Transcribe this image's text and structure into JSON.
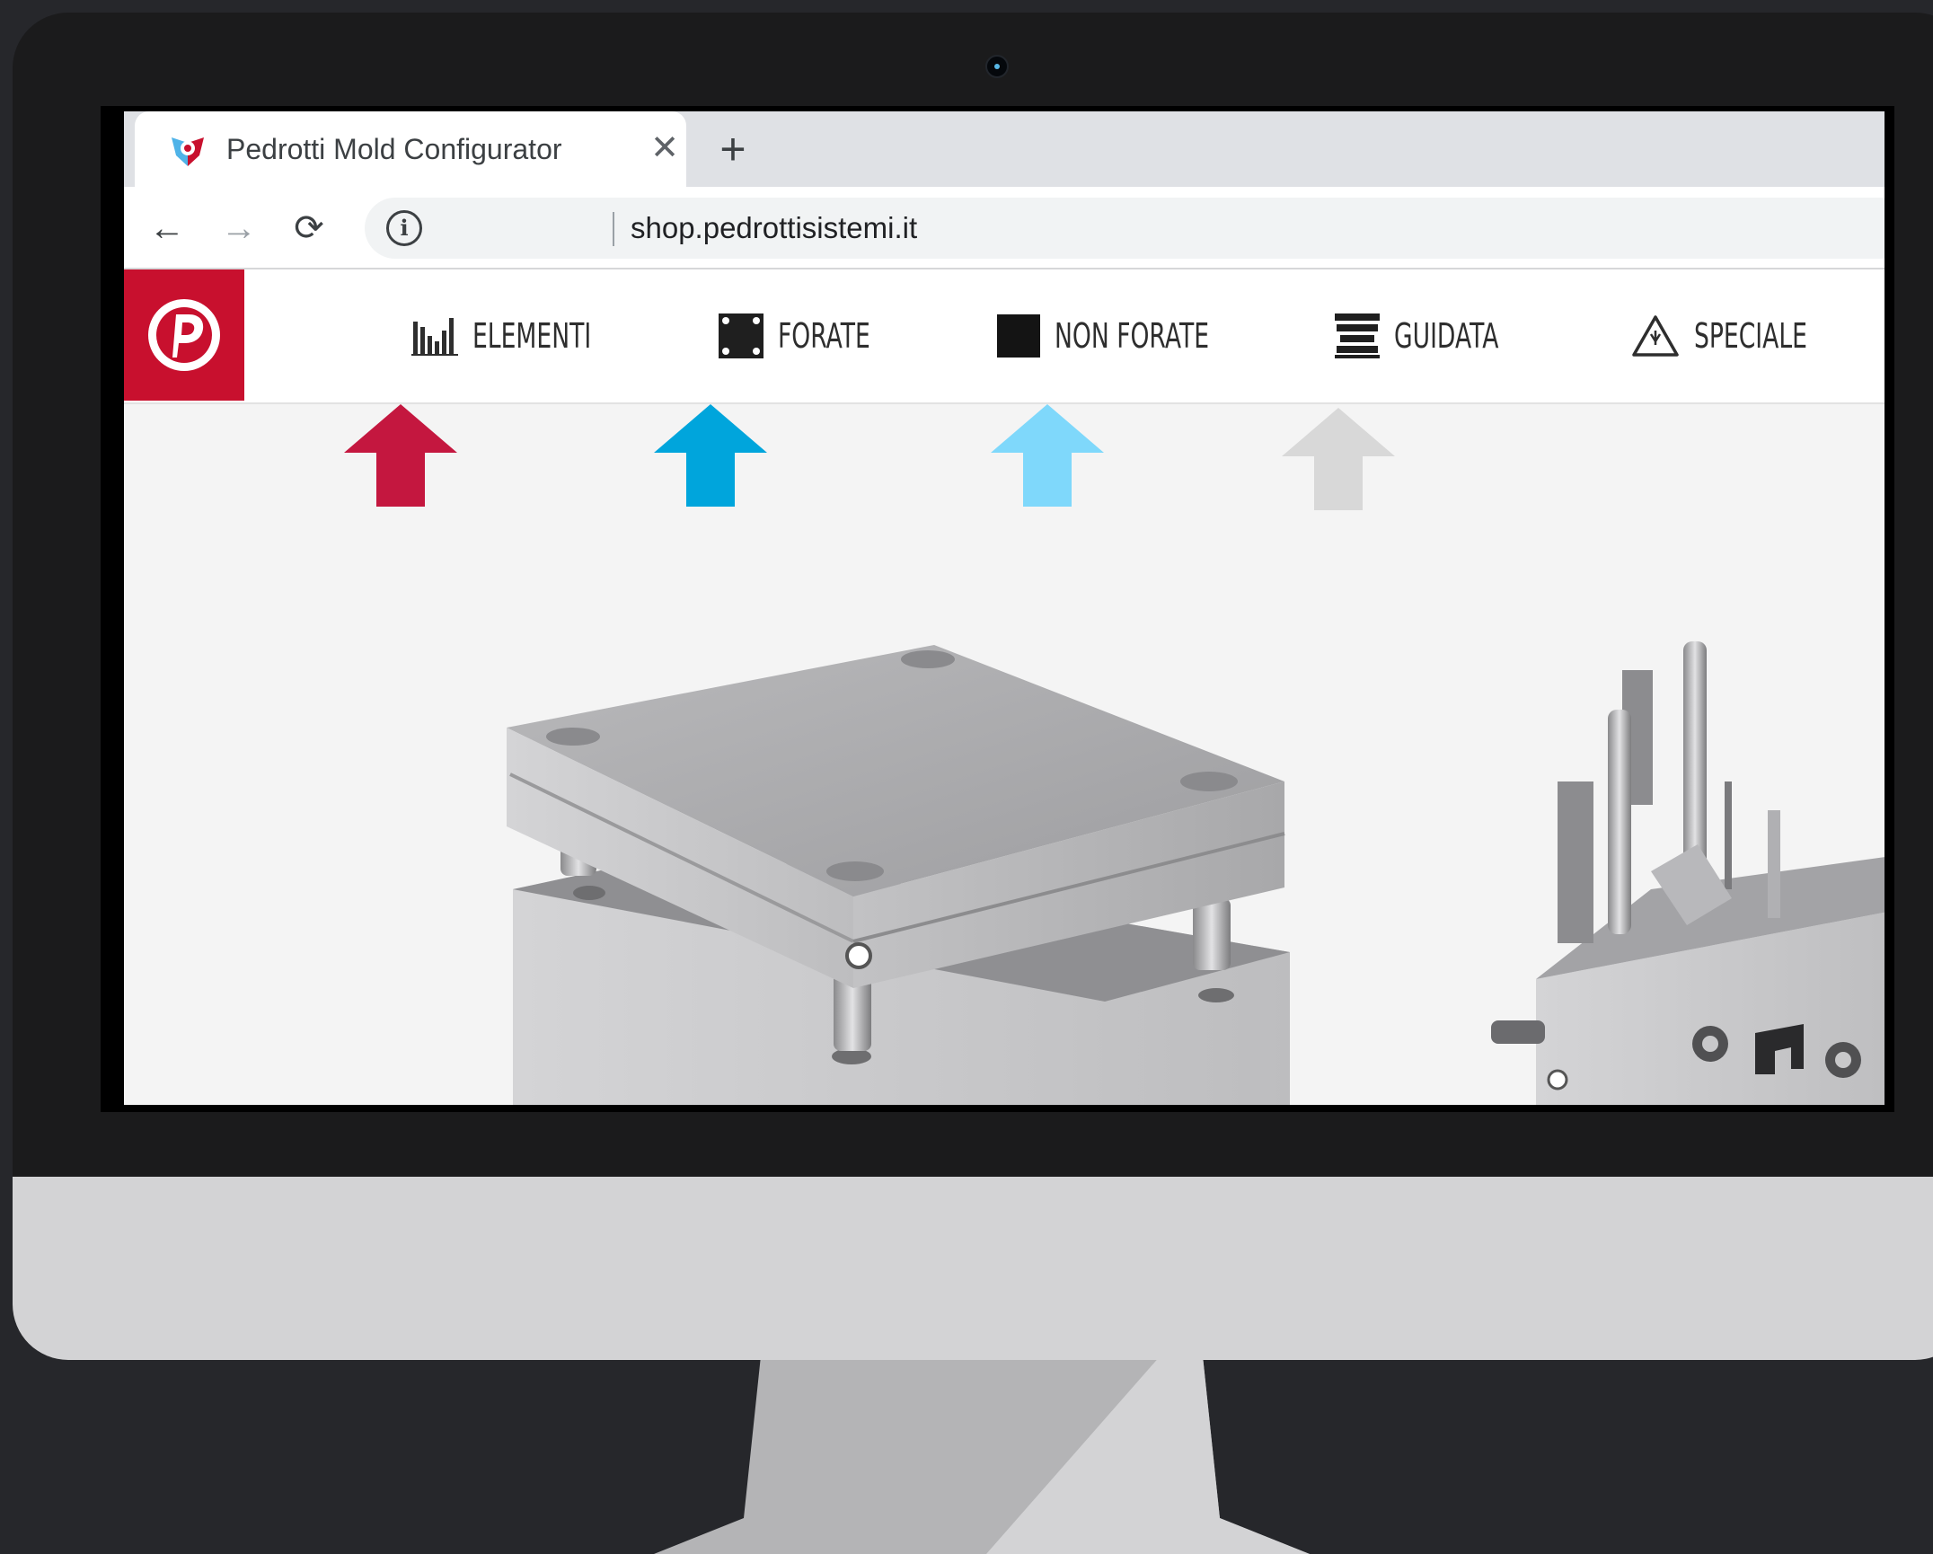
{
  "browser": {
    "tab": {
      "title": "Pedrotti Mold Configurator",
      "close_label": "✕"
    },
    "new_tab_label": "+",
    "nav": {
      "back_label": "←",
      "forward_label": "→",
      "reload_label": "⟳"
    },
    "site_info_label": "i",
    "url": "shop.pedrottisistemi.it"
  },
  "site": {
    "menu": [
      {
        "label": "ELEMENTI",
        "icon": "bar-chart-icon",
        "arrow_color": "#c4173f"
      },
      {
        "label": "FORATE",
        "icon": "drilled-plate-icon",
        "arrow_color": "#00a5dc"
      },
      {
        "label": "NON FORATE",
        "icon": "solid-plate-icon",
        "arrow_color": "#7fd8fb"
      },
      {
        "label": "GUIDATA",
        "icon": "guided-mold-icon",
        "arrow_color": "#d8d8d8"
      },
      {
        "label": "SPECIALE",
        "icon": "warning-triangle-icon"
      }
    ]
  },
  "colors": {
    "brand_red": "#c8102e",
    "background": "#26272b",
    "bezel": "#1b1b1c",
    "chin": "#d3d3d5"
  }
}
